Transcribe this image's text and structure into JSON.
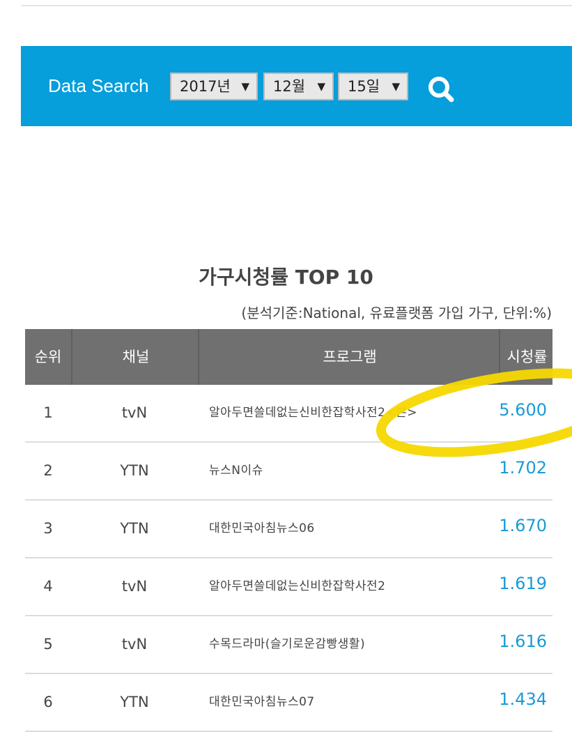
{
  "search": {
    "label": "Data Search",
    "year": "2017년",
    "month": "12월",
    "day": "15일",
    "arrow": "▼",
    "button_icon": "search-icon"
  },
  "title": "가구시청률 TOP 10",
  "subtitle": "(분석기준:National, 유료플랫폼 가입 가구, 단위:%)",
  "table": {
    "headers": [
      "순위",
      "채널",
      "프로그램",
      "시청률"
    ],
    "rows": [
      {
        "rank": "1",
        "channel": "tvN",
        "program": "알아두면쓸데없는신비한잡학사전2<본>",
        "rating": "5.600"
      },
      {
        "rank": "2",
        "channel": "YTN",
        "program": "뉴스N이슈",
        "rating": "1.702"
      },
      {
        "rank": "3",
        "channel": "YTN",
        "program": "대한민국아침뉴스06",
        "rating": "1.670"
      },
      {
        "rank": "4",
        "channel": "tvN",
        "program": "알아두면쓸데없는신비한잡학사전2",
        "rating": "1.619"
      },
      {
        "rank": "5",
        "channel": "tvN",
        "program": "수목드라마(슬기로운감빵생활)",
        "rating": "1.616"
      },
      {
        "rank": "6",
        "channel": "YTN",
        "program": "대한민국아침뉴스07",
        "rating": "1.434"
      }
    ]
  },
  "colors": {
    "search_bar": "#069edb",
    "header_bg": "#707070",
    "rating": "#1a9ad6",
    "highlight": "#f5d800"
  }
}
